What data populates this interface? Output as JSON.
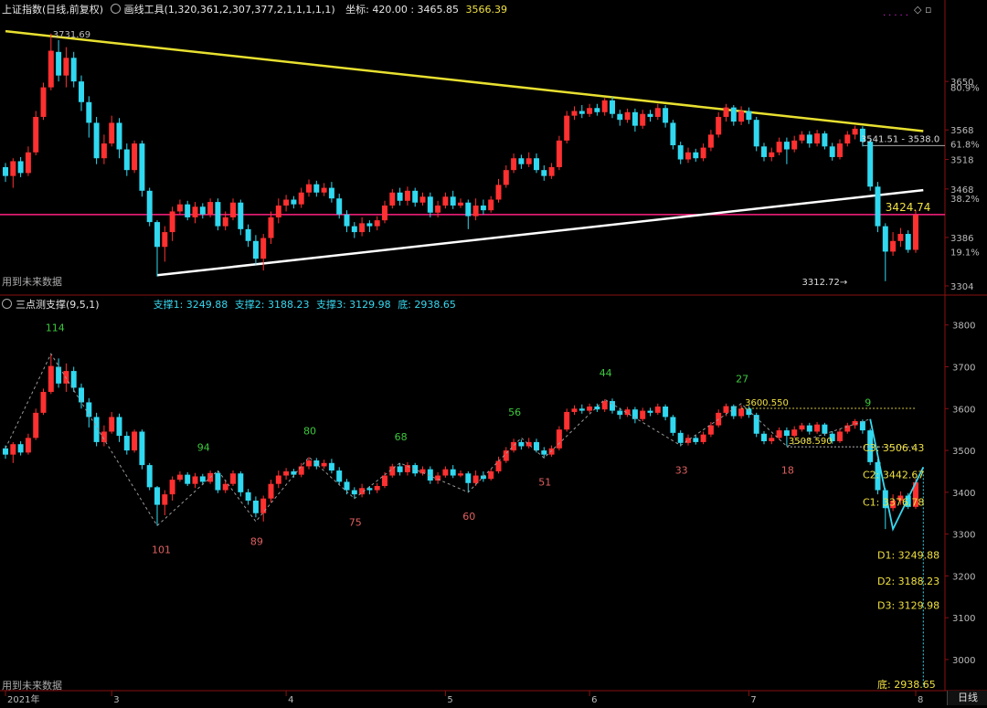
{
  "header": {
    "index_name": "上证指数(日线,前复权)",
    "draw_tool": "画线工具(1,320,361,2,307,377,2,1,1,1,1,1)",
    "coord_label": "坐标: 420.00 : 3465.85",
    "price_value": "3566.39",
    "window_controls": "◇ ▫"
  },
  "sub_header": {
    "indicator_name": "三点测支撑(9,5,1)",
    "support1": "支撑1: 3249.88",
    "support2": "支撑2: 3188.23",
    "support3": "支撑3: 3129.98",
    "bottom": "底: 2938.65"
  },
  "notes": {
    "future_data_top": "用到未来数据",
    "future_data_bottom": "用到未来数据"
  },
  "x_axis": {
    "labels": [
      "2021年",
      "3",
      "4",
      "5",
      "6",
      "7",
      "8"
    ],
    "period_tab": "日线"
  },
  "main_axis": {
    "ticks": [
      "3650",
      "3568",
      "3518",
      "3468",
      "3386",
      "3304"
    ],
    "pct": [
      "80.9%",
      "61.8%",
      "38.2%",
      "19.1%"
    ]
  },
  "sub_axis": {
    "ticks": [
      "3800",
      "3700",
      "3600",
      "3500",
      "3400",
      "3300",
      "3200",
      "3100",
      "3000"
    ]
  },
  "annotations_main": {
    "high_label": "3731.69",
    "band_label": "3541.51 - 3538.0",
    "current_label": "3424.74",
    "low_label": "3312.72→"
  },
  "annotations_sub": {
    "counts_top": [
      "114",
      "94",
      "80",
      "68",
      "56",
      "44",
      "27",
      "9"
    ],
    "counts_bottom": [
      "101",
      "89",
      "75",
      "60",
      "51",
      "33",
      "18"
    ],
    "level_3600": "3600.550",
    "level_3508": "3508.590",
    "C3": "C3: 3506.43",
    "C2": "C2: 3442.67",
    "C1": "C1: 3376.78",
    "D1": "D1: 3249.88",
    "D2": "D2: 3188.23",
    "D3": "D3: 3129.98",
    "bottom": "底: 2938.65"
  },
  "colors": {
    "up": "#ff3030",
    "down": "#30d8f0",
    "yellow_line": "#e8e030",
    "white_line": "#ffffff",
    "magenta_line": "#ff2080"
  },
  "chart_data": {
    "type": "candlestick",
    "candles": [
      {
        "o": 3505,
        "c": 3490,
        "h": 3512,
        "l": 3480
      },
      {
        "o": 3490,
        "c": 3515,
        "h": 3520,
        "l": 3470
      },
      {
        "o": 3515,
        "c": 3495,
        "h": 3522,
        "l": 3488
      },
      {
        "o": 3495,
        "c": 3530,
        "h": 3540,
        "l": 3490
      },
      {
        "o": 3530,
        "c": 3590,
        "h": 3600,
        "l": 3525
      },
      {
        "o": 3590,
        "c": 3640,
        "h": 3648,
        "l": 3585
      },
      {
        "o": 3640,
        "c": 3702,
        "h": 3731,
        "l": 3635
      },
      {
        "o": 3700,
        "c": 3660,
        "h": 3720,
        "l": 3650
      },
      {
        "o": 3660,
        "c": 3690,
        "h": 3708,
        "l": 3640
      },
      {
        "o": 3690,
        "c": 3650,
        "h": 3700,
        "l": 3640
      },
      {
        "o": 3650,
        "c": 3615,
        "h": 3660,
        "l": 3600
      },
      {
        "o": 3615,
        "c": 3580,
        "h": 3625,
        "l": 3555
      },
      {
        "o": 3580,
        "c": 3520,
        "h": 3590,
        "l": 3510
      },
      {
        "o": 3520,
        "c": 3545,
        "h": 3560,
        "l": 3510
      },
      {
        "o": 3545,
        "c": 3580,
        "h": 3592,
        "l": 3540
      },
      {
        "o": 3580,
        "c": 3535,
        "h": 3588,
        "l": 3520
      },
      {
        "o": 3535,
        "c": 3500,
        "h": 3545,
        "l": 3490
      },
      {
        "o": 3500,
        "c": 3545,
        "h": 3550,
        "l": 3495
      },
      {
        "o": 3545,
        "c": 3465,
        "h": 3550,
        "l": 3455
      },
      {
        "o": 3465,
        "c": 3412,
        "h": 3470,
        "l": 3405
      },
      {
        "o": 3412,
        "c": 3370,
        "h": 3415,
        "l": 3320
      },
      {
        "o": 3370,
        "c": 3395,
        "h": 3405,
        "l": 3345
      },
      {
        "o": 3395,
        "c": 3430,
        "h": 3438,
        "l": 3380
      },
      {
        "o": 3430,
        "c": 3442,
        "h": 3450,
        "l": 3425
      },
      {
        "o": 3442,
        "c": 3420,
        "h": 3448,
        "l": 3415
      },
      {
        "o": 3420,
        "c": 3438,
        "h": 3446,
        "l": 3410
      },
      {
        "o": 3438,
        "c": 3425,
        "h": 3444,
        "l": 3418
      },
      {
        "o": 3425,
        "c": 3446,
        "h": 3452,
        "l": 3420
      },
      {
        "o": 3446,
        "c": 3405,
        "h": 3452,
        "l": 3398
      },
      {
        "o": 3405,
        "c": 3420,
        "h": 3430,
        "l": 3398
      },
      {
        "o": 3420,
        "c": 3445,
        "h": 3452,
        "l": 3415
      },
      {
        "o": 3445,
        "c": 3400,
        "h": 3450,
        "l": 3390
      },
      {
        "o": 3400,
        "c": 3380,
        "h": 3408,
        "l": 3370
      },
      {
        "o": 3380,
        "c": 3350,
        "h": 3390,
        "l": 3340
      },
      {
        "o": 3350,
        "c": 3385,
        "h": 3392,
        "l": 3330
      },
      {
        "o": 3385,
        "c": 3420,
        "h": 3430,
        "l": 3375
      },
      {
        "o": 3420,
        "c": 3440,
        "h": 3452,
        "l": 3410
      },
      {
        "o": 3440,
        "c": 3450,
        "h": 3458,
        "l": 3430
      },
      {
        "o": 3450,
        "c": 3442,
        "h": 3456,
        "l": 3435
      },
      {
        "o": 3442,
        "c": 3462,
        "h": 3470,
        "l": 3436
      },
      {
        "o": 3462,
        "c": 3476,
        "h": 3484,
        "l": 3455
      },
      {
        "o": 3476,
        "c": 3462,
        "h": 3482,
        "l": 3455
      },
      {
        "o": 3462,
        "c": 3470,
        "h": 3478,
        "l": 3456
      },
      {
        "o": 3470,
        "c": 3452,
        "h": 3480,
        "l": 3445
      },
      {
        "o": 3452,
        "c": 3425,
        "h": 3460,
        "l": 3418
      },
      {
        "o": 3425,
        "c": 3405,
        "h": 3432,
        "l": 3395
      },
      {
        "o": 3405,
        "c": 3395,
        "h": 3412,
        "l": 3385
      },
      {
        "o": 3395,
        "c": 3410,
        "h": 3420,
        "l": 3388
      },
      {
        "o": 3410,
        "c": 3405,
        "h": 3415,
        "l": 3395
      },
      {
        "o": 3405,
        "c": 3415,
        "h": 3422,
        "l": 3398
      },
      {
        "o": 3415,
        "c": 3440,
        "h": 3448,
        "l": 3410
      },
      {
        "o": 3440,
        "c": 3462,
        "h": 3468,
        "l": 3435
      },
      {
        "o": 3462,
        "c": 3448,
        "h": 3470,
        "l": 3440
      },
      {
        "o": 3448,
        "c": 3465,
        "h": 3472,
        "l": 3440
      },
      {
        "o": 3465,
        "c": 3445,
        "h": 3470,
        "l": 3438
      },
      {
        "o": 3445,
        "c": 3455,
        "h": 3462,
        "l": 3440
      },
      {
        "o": 3455,
        "c": 3428,
        "h": 3462,
        "l": 3420
      },
      {
        "o": 3428,
        "c": 3440,
        "h": 3448,
        "l": 3420
      },
      {
        "o": 3440,
        "c": 3455,
        "h": 3462,
        "l": 3435
      },
      {
        "o": 3455,
        "c": 3440,
        "h": 3465,
        "l": 3434
      },
      {
        "o": 3440,
        "c": 3445,
        "h": 3452,
        "l": 3436
      },
      {
        "o": 3445,
        "c": 3422,
        "h": 3450,
        "l": 3400
      },
      {
        "o": 3422,
        "c": 3440,
        "h": 3452,
        "l": 3415
      },
      {
        "o": 3440,
        "c": 3432,
        "h": 3450,
        "l": 3425
      },
      {
        "o": 3432,
        "c": 3450,
        "h": 3456,
        "l": 3428
      },
      {
        "o": 3450,
        "c": 3475,
        "h": 3485,
        "l": 3445
      },
      {
        "o": 3475,
        "c": 3500,
        "h": 3508,
        "l": 3470
      },
      {
        "o": 3500,
        "c": 3520,
        "h": 3528,
        "l": 3495
      },
      {
        "o": 3520,
        "c": 3510,
        "h": 3526,
        "l": 3502
      },
      {
        "o": 3510,
        "c": 3520,
        "h": 3530,
        "l": 3505
      },
      {
        "o": 3520,
        "c": 3500,
        "h": 3528,
        "l": 3495
      },
      {
        "o": 3500,
        "c": 3490,
        "h": 3508,
        "l": 3482
      },
      {
        "o": 3490,
        "c": 3505,
        "h": 3512,
        "l": 3485
      },
      {
        "o": 3505,
        "c": 3550,
        "h": 3558,
        "l": 3500
      },
      {
        "o": 3550,
        "c": 3592,
        "h": 3600,
        "l": 3545
      },
      {
        "o": 3592,
        "c": 3600,
        "h": 3608,
        "l": 3585
      },
      {
        "o": 3600,
        "c": 3595,
        "h": 3610,
        "l": 3588
      },
      {
        "o": 3595,
        "c": 3605,
        "h": 3612,
        "l": 3590
      },
      {
        "o": 3605,
        "c": 3598,
        "h": 3612,
        "l": 3592
      },
      {
        "o": 3598,
        "c": 3618,
        "h": 3622,
        "l": 3592
      },
      {
        "o": 3618,
        "c": 3595,
        "h": 3624,
        "l": 3588
      },
      {
        "o": 3595,
        "c": 3585,
        "h": 3602,
        "l": 3575
      },
      {
        "o": 3585,
        "c": 3598,
        "h": 3604,
        "l": 3580
      },
      {
        "o": 3598,
        "c": 3575,
        "h": 3604,
        "l": 3565
      },
      {
        "o": 3575,
        "c": 3595,
        "h": 3602,
        "l": 3570
      },
      {
        "o": 3595,
        "c": 3590,
        "h": 3602,
        "l": 3582
      },
      {
        "o": 3590,
        "c": 3605,
        "h": 3612,
        "l": 3585
      },
      {
        "o": 3605,
        "c": 3580,
        "h": 3610,
        "l": 3572
      },
      {
        "o": 3580,
        "c": 3542,
        "h": 3585,
        "l": 3535
      },
      {
        "o": 3542,
        "c": 3518,
        "h": 3548,
        "l": 3510
      },
      {
        "o": 3518,
        "c": 3530,
        "h": 3538,
        "l": 3512
      },
      {
        "o": 3530,
        "c": 3520,
        "h": 3536,
        "l": 3514
      },
      {
        "o": 3520,
        "c": 3538,
        "h": 3545,
        "l": 3515
      },
      {
        "o": 3538,
        "c": 3560,
        "h": 3568,
        "l": 3532
      },
      {
        "o": 3560,
        "c": 3590,
        "h": 3598,
        "l": 3555
      },
      {
        "o": 3590,
        "c": 3606,
        "h": 3612,
        "l": 3582
      },
      {
        "o": 3606,
        "c": 3582,
        "h": 3610,
        "l": 3575
      },
      {
        "o": 3582,
        "c": 3600,
        "h": 3608,
        "l": 3576
      },
      {
        "o": 3600,
        "c": 3585,
        "h": 3606,
        "l": 3578
      },
      {
        "o": 3585,
        "c": 3540,
        "h": 3590,
        "l": 3532
      },
      {
        "o": 3540,
        "c": 3522,
        "h": 3546,
        "l": 3515
      },
      {
        "o": 3522,
        "c": 3530,
        "h": 3538,
        "l": 3515
      },
      {
        "o": 3530,
        "c": 3548,
        "h": 3555,
        "l": 3525
      },
      {
        "o": 3548,
        "c": 3535,
        "h": 3555,
        "l": 3510
      },
      {
        "o": 3535,
        "c": 3550,
        "h": 3558,
        "l": 3530
      },
      {
        "o": 3550,
        "c": 3560,
        "h": 3566,
        "l": 3545
      },
      {
        "o": 3560,
        "c": 3545,
        "h": 3566,
        "l": 3538
      },
      {
        "o": 3545,
        "c": 3562,
        "h": 3568,
        "l": 3540
      },
      {
        "o": 3562,
        "c": 3540,
        "h": 3566,
        "l": 3535
      },
      {
        "o": 3540,
        "c": 3522,
        "h": 3546,
        "l": 3516
      },
      {
        "o": 3522,
        "c": 3545,
        "h": 3552,
        "l": 3518
      },
      {
        "o": 3545,
        "c": 3560,
        "h": 3566,
        "l": 3540
      },
      {
        "o": 3560,
        "c": 3570,
        "h": 3575,
        "l": 3552
      },
      {
        "o": 3570,
        "c": 3548,
        "h": 3574,
        "l": 3540
      },
      {
        "o": 3548,
        "c": 3472,
        "h": 3552,
        "l": 3465
      },
      {
        "o": 3472,
        "c": 3405,
        "h": 3480,
        "l": 3395
      },
      {
        "o": 3405,
        "c": 3362,
        "h": 3410,
        "l": 3312
      },
      {
        "o": 3362,
        "c": 3380,
        "h": 3395,
        "l": 3355
      },
      {
        "o": 3380,
        "c": 3392,
        "h": 3402,
        "l": 3370
      },
      {
        "o": 3392,
        "c": 3365,
        "h": 3398,
        "l": 3360
      },
      {
        "o": 3365,
        "c": 3424,
        "h": 3432,
        "l": 3360
      }
    ],
    "ytop_range": [
      3290,
      3760
    ],
    "ybot_range": [
      2930,
      3830
    ],
    "yellow_trend": [
      [
        0,
        3735
      ],
      [
        121,
        3566
      ]
    ],
    "white_trend": [
      [
        20,
        3322
      ],
      [
        121,
        3466
      ]
    ],
    "magenta_level": 3424.74,
    "ref_3541": 3541.51,
    "ref_3600": 3600.55,
    "ref_3508": 3508.59,
    "low_zigzag": [
      [
        0,
        3505
      ],
      [
        6,
        3731
      ],
      [
        10,
        3615
      ],
      [
        20,
        3320
      ],
      [
        28,
        3452
      ],
      [
        33,
        3330
      ],
      [
        40,
        3484
      ],
      [
        46,
        3385
      ],
      [
        52,
        3470
      ],
      [
        61,
        3400
      ],
      [
        68,
        3530
      ],
      [
        71,
        3482
      ],
      [
        79,
        3622
      ],
      [
        89,
        3512
      ],
      [
        97,
        3612
      ],
      [
        103,
        3510
      ],
      [
        114,
        3575
      ],
      [
        117,
        3312
      ],
      [
        121,
        3460
      ]
    ],
    "count_top_at": [
      6,
      26,
      40,
      52,
      67,
      79,
      97,
      114
    ],
    "count_bottom_at": [
      20,
      33,
      46,
      61,
      71,
      89,
      103
    ],
    "c_levels": [
      3506.43,
      3442.67,
      3376.78
    ],
    "d_levels": [
      3249.88,
      3188.23,
      3129.98
    ],
    "bottom_level": 2938.65,
    "x_month_at": [
      0,
      14,
      37,
      58,
      77,
      98,
      120
    ]
  }
}
